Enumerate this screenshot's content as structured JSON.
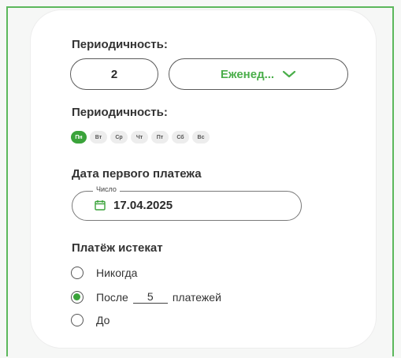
{
  "frequency": {
    "title": "Периодичность:",
    "interval_value": "2",
    "period_selected": "Еженед..."
  },
  "weekdays": {
    "title": "Периодичность:",
    "days": [
      "Пн",
      "Вт",
      "Ср",
      "Чт",
      "Пт",
      "Сб",
      "Вс"
    ],
    "active_index": 0
  },
  "first_payment": {
    "title": "Дата первого платежа",
    "legend": "Число",
    "value": "17.04.2025"
  },
  "expiry": {
    "title": "Платёж истекат",
    "options": {
      "never": "Никогда",
      "after_prefix": "После",
      "after_count": "5",
      "after_suffix": "платежей",
      "until": "До"
    },
    "selected": "after"
  },
  "colors": {
    "accent": "#3aa33a",
    "select_text": "#4aae4a",
    "frame": "#5cb85c"
  },
  "icons": [
    "chevron-down-icon",
    "calendar-icon"
  ]
}
